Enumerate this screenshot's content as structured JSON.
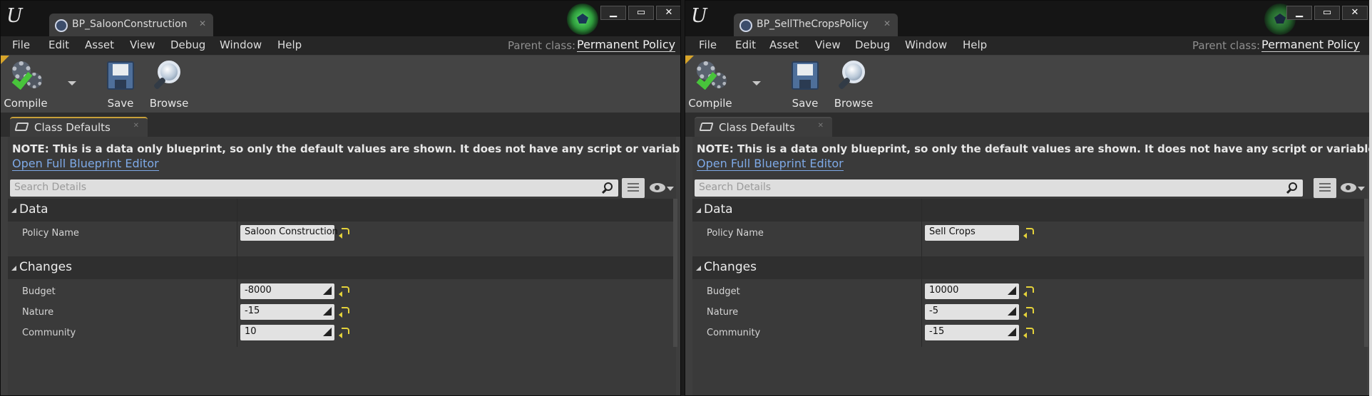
{
  "windows": [
    {
      "tab_title": "BP_SaloonConstructionP",
      "menu": [
        "File",
        "Edit",
        "Asset",
        "View",
        "Debug",
        "Window",
        "Help"
      ],
      "parent_class_label": "Parent class:",
      "parent_class_value": "Permanent Policy",
      "toolbar": {
        "compile": "Compile",
        "save": "Save",
        "browse": "Browse"
      },
      "panel_tab": "Class Defaults",
      "note": "NOTE: This is a data only blueprint, so only the default values are shown.  It does not have any script or variables.  If you want to add some,",
      "open_editor_link": "Open Full Blueprint Editor",
      "search_placeholder": "Search Details",
      "sections": {
        "data": {
          "title": "Data",
          "policy_name_label": "Policy Name",
          "policy_name_value": "Saloon Construction"
        },
        "changes": {
          "title": "Changes",
          "budget_label": "Budget",
          "budget_value": "-8000",
          "nature_label": "Nature",
          "nature_value": "-15",
          "community_label": "Community",
          "community_value": "10"
        }
      }
    },
    {
      "tab_title": "BP_SellTheCropsPolicy",
      "menu": [
        "File",
        "Edit",
        "Asset",
        "View",
        "Debug",
        "Window",
        "Help"
      ],
      "parent_class_label": "Parent class:",
      "parent_class_value": "Permanent Policy",
      "toolbar": {
        "compile": "Compile",
        "save": "Save",
        "browse": "Browse"
      },
      "panel_tab": "Class Defaults",
      "note": "NOTE: This is a data only blueprint, so only the default values are shown.  It does not have any script or variables.  If you want to add some,",
      "open_editor_link": "Open Full Blueprint Editor",
      "search_placeholder": "Search Details",
      "sections": {
        "data": {
          "title": "Data",
          "policy_name_label": "Policy Name",
          "policy_name_value": "Sell Crops"
        },
        "changes": {
          "title": "Changes",
          "budget_label": "Budget",
          "budget_value": "10000",
          "nature_label": "Nature",
          "nature_value": "-5",
          "community_label": "Community",
          "community_value": "-15"
        }
      }
    }
  ],
  "colors": {
    "accent_link": "#7ea9e6",
    "status_glow": "#4fdc5e",
    "reset_arrow": "#e4d23a",
    "tab_highlight": "#c8a03a"
  }
}
